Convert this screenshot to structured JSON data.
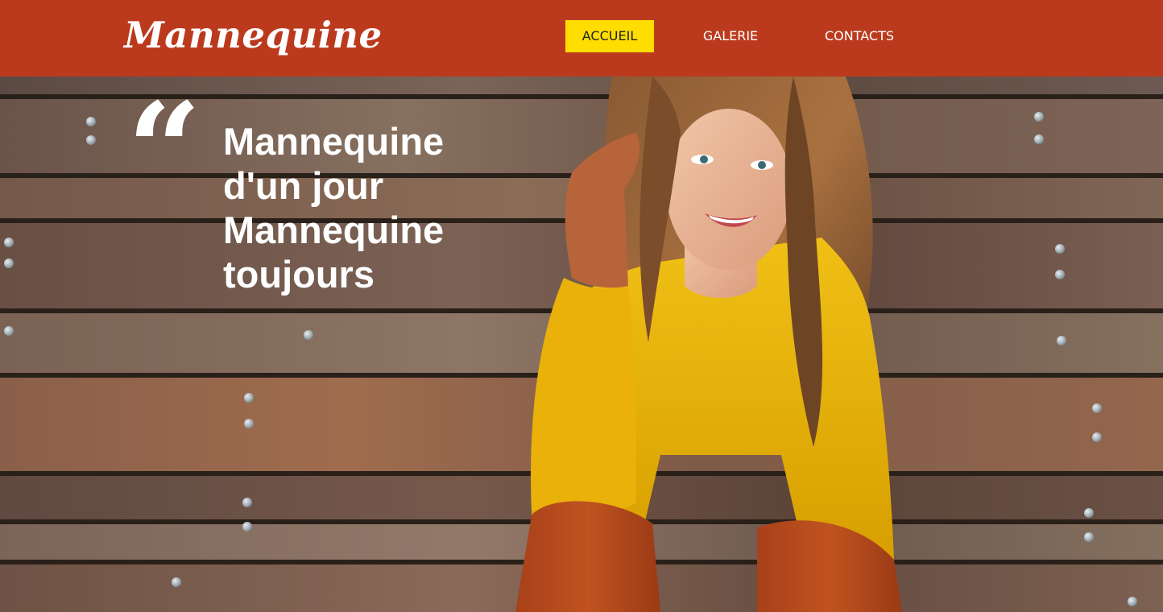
{
  "header": {
    "logo": "Mannequine",
    "nav": [
      {
        "label": "ACCUEIL",
        "active": true
      },
      {
        "label": "GALERIE",
        "active": false
      },
      {
        "label": "CONTACTS",
        "active": false
      }
    ]
  },
  "hero": {
    "quote_mark": "“",
    "quote_lines": [
      "Mannequine",
      "d'un jour",
      "Mannequine",
      "toujours"
    ]
  },
  "colors": {
    "header_bg": "#bb3a1d",
    "active_nav_bg": "#ffdd00",
    "text_light": "#ffffff",
    "wood": "#6d5649",
    "sweater": "#e7b400",
    "pants": "#b24a1c"
  }
}
